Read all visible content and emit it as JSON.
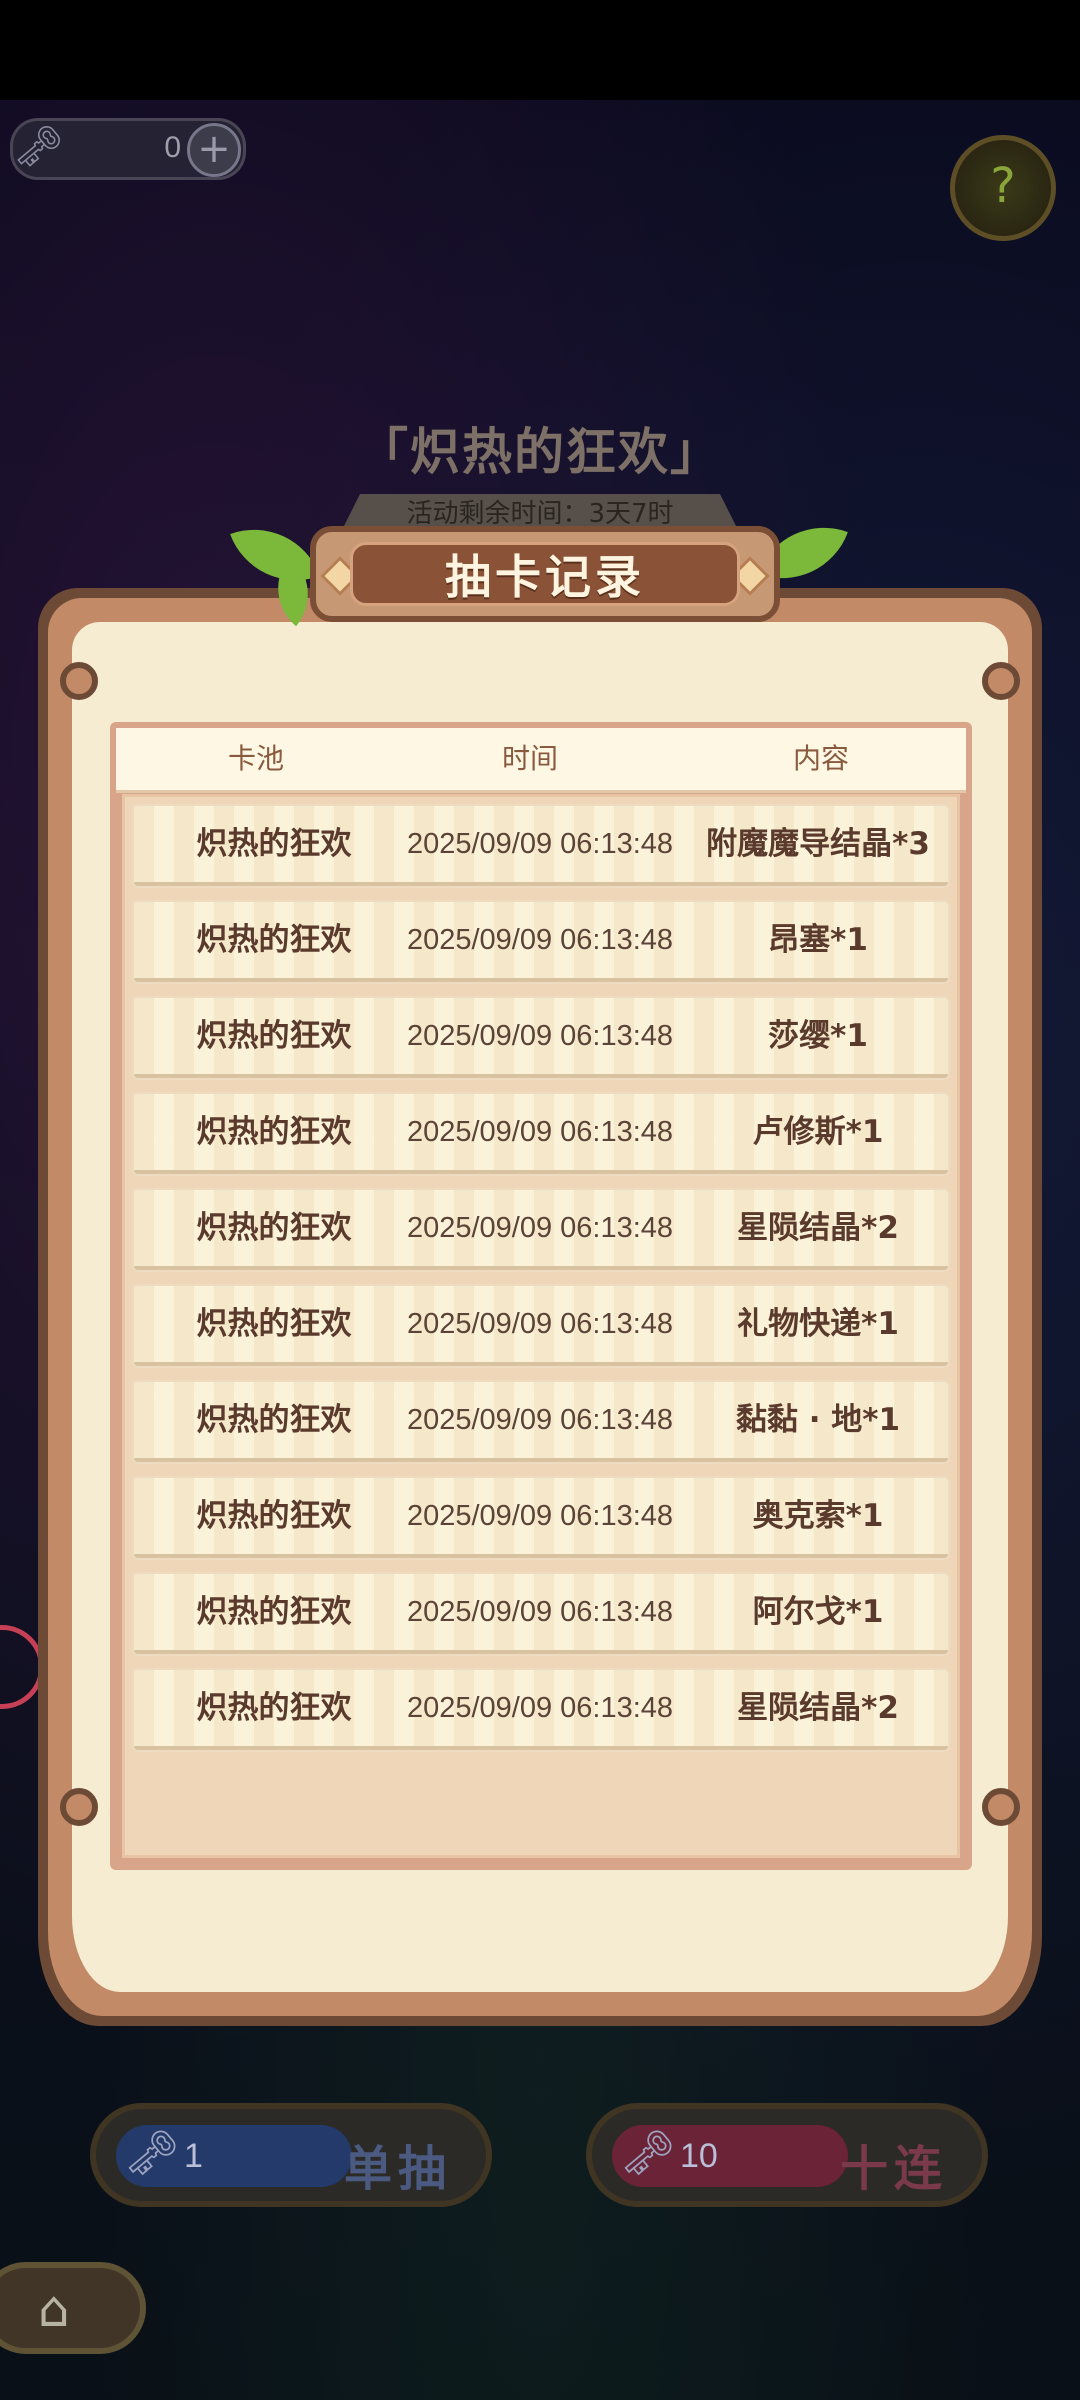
{
  "currency": {
    "key_icon": "key-icon",
    "count": "0",
    "plus": "+"
  },
  "event": {
    "title": "「炽热的狂欢」",
    "timer": "活动剩余时间：3天7时"
  },
  "dialog": {
    "title": "抽卡记录",
    "columns": [
      "卡池",
      "时间",
      "内容"
    ],
    "records": [
      {
        "pool": "炽热的狂欢",
        "time": "2025/09/09 06:13:48",
        "content": "附魔魔导结晶*3"
      },
      {
        "pool": "炽热的狂欢",
        "time": "2025/09/09 06:13:48",
        "content": "昂塞*1"
      },
      {
        "pool": "炽热的狂欢",
        "time": "2025/09/09 06:13:48",
        "content": "莎缨*1"
      },
      {
        "pool": "炽热的狂欢",
        "time": "2025/09/09 06:13:48",
        "content": "卢修斯*1"
      },
      {
        "pool": "炽热的狂欢",
        "time": "2025/09/09 06:13:48",
        "content": "星陨结晶*2"
      },
      {
        "pool": "炽热的狂欢",
        "time": "2025/09/09 06:13:48",
        "content": "礼物快递*1"
      },
      {
        "pool": "炽热的狂欢",
        "time": "2025/09/09 06:13:48",
        "content": "黏黏 · 地*1"
      },
      {
        "pool": "炽热的狂欢",
        "time": "2025/09/09 06:13:48",
        "content": "奥克索*1"
      },
      {
        "pool": "炽热的狂欢",
        "time": "2025/09/09 06:13:48",
        "content": "阿尔戈*1"
      },
      {
        "pool": "炽热的狂欢",
        "time": "2025/09/09 06:13:48",
        "content": "星陨结晶*2"
      }
    ]
  },
  "single_draw": {
    "cost": "1",
    "label": "单抽",
    "color": "#233a6b"
  },
  "ten_draw": {
    "cost": "10",
    "label": "十连",
    "color": "#6b2338"
  },
  "colors": {
    "panel_border": "#6d4a36",
    "panel_bg": "#f6ecd2",
    "row_text": "#5a3a2c",
    "title_text": "#fff4e0"
  }
}
